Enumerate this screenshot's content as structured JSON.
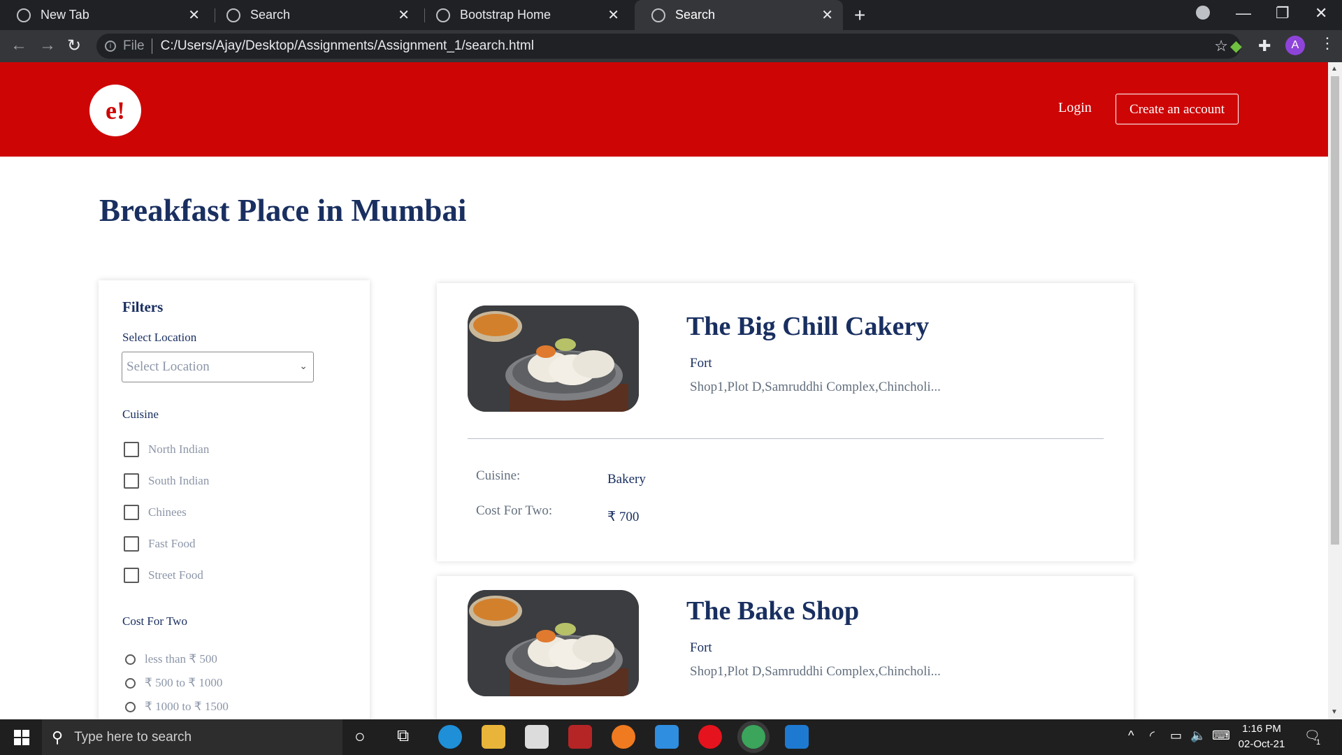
{
  "browser": {
    "tabs": [
      {
        "title": "New Tab"
      },
      {
        "title": "Search"
      },
      {
        "title": "Bootstrap Home"
      },
      {
        "title": "Search"
      }
    ],
    "active_tab": 3,
    "address_scheme": "File",
    "address_url": "C:/Users/Ajay/Desktop/Assignments/Assignment_1/search.html",
    "profile_initial": "A"
  },
  "header": {
    "logo_text": "e!",
    "login_label": "Login",
    "create_account_label": "Create an account",
    "brand_color": "#ce0505"
  },
  "page": {
    "title": "Breakfast Place in Mumbai"
  },
  "filters": {
    "title": "Filters",
    "location_label": "Select Location",
    "location_placeholder": "Select Location",
    "cuisine_label": "Cuisine",
    "cuisines": [
      "North Indian",
      "South Indian",
      "Chinees",
      "Fast Food",
      "Street Food"
    ],
    "cost_label": "Cost For Two",
    "cost_options": [
      "less than ₹ 500",
      "₹ 500 to ₹ 1000",
      "₹ 1000 to ₹ 1500"
    ]
  },
  "results": [
    {
      "name": "The Big Chill Cakery",
      "locality": "Fort",
      "address": "Shop1,Plot D,Samruddhi Complex,Chincholi...",
      "cuisine_label": "Cuisine:",
      "cuisine": "Bakery",
      "cost_label": "Cost For Two:",
      "cost": "₹ 700"
    },
    {
      "name": "The Bake Shop",
      "locality": "Fort",
      "address": "Shop1,Plot D,Samruddhi Complex,Chincholi..."
    }
  ],
  "taskbar": {
    "search_placeholder": "Type here to search",
    "time": "1:16 PM",
    "date": "02-Oct-21",
    "notification_count": "1"
  }
}
